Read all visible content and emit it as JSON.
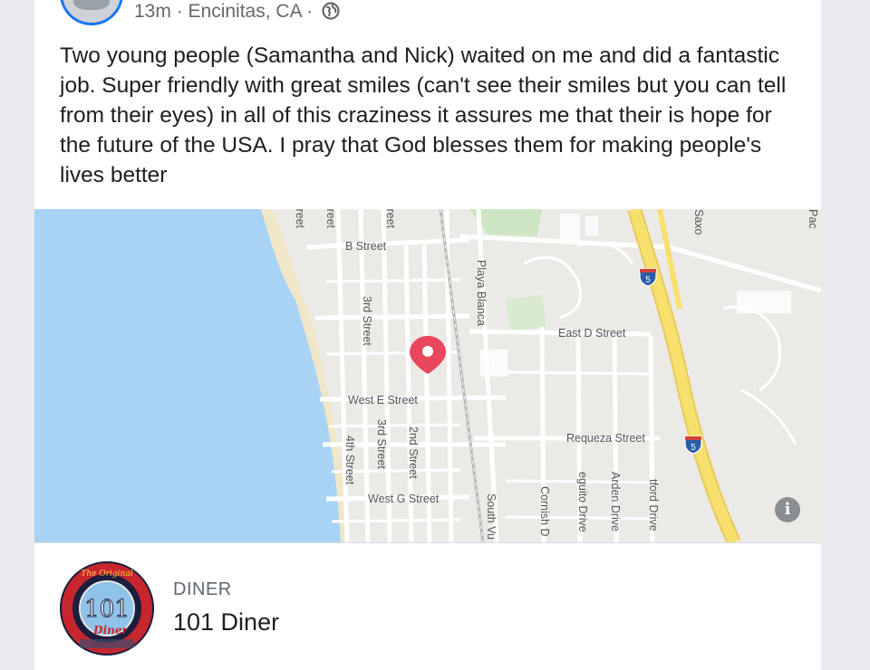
{
  "post": {
    "time": "13m",
    "separator1": " · ",
    "location": "Encinitas, CA",
    "separator2": " · ",
    "privacy_icon": "globe-icon",
    "text": "Two young people (Samantha and Nick) waited on me and did a fantastic job.  Super friendly with great smiles (can't  see their smiles but you can tell from their eyes)  in all of this craziness it assures me that their is hope for the future of the USA. I pray that God blesses them for making people's lives better"
  },
  "map": {
    "marker_icon": "map-pin-icon",
    "info_label": "i",
    "highway_label": "5",
    "streets": {
      "b_street": "B Street",
      "east_d_street": "East D Street",
      "west_e_street": "West E Street",
      "requeza_street": "Requeza Street",
      "west_g_street": "West G Street",
      "playa_blanca": "Playa Blanca",
      "third_street_upper": "3rd Street",
      "third_street_lower": "3rd Street",
      "second_street": "2nd Street",
      "fourth_street": "4th Street",
      "south_vu": "South Vu",
      "cornish": "Cornish D",
      "neguito": "eguito Drive",
      "arden": "Arden Drive",
      "stratford": "tford Drive",
      "saxony": "Saxo",
      "pac": "Pac",
      "treet1": "treet",
      "treet2": "treet",
      "treet3": "treet"
    },
    "colors": {
      "water": "#a9d3f5",
      "land": "#eceae6",
      "highway": "#f7e06e",
      "park": "#cfe6c4",
      "marker": "#e8475e"
    }
  },
  "place": {
    "category": "DINER",
    "name": "101 Diner",
    "logo_text_top": "The Original",
    "logo_number": "101",
    "logo_text_bottom": "Diner"
  }
}
